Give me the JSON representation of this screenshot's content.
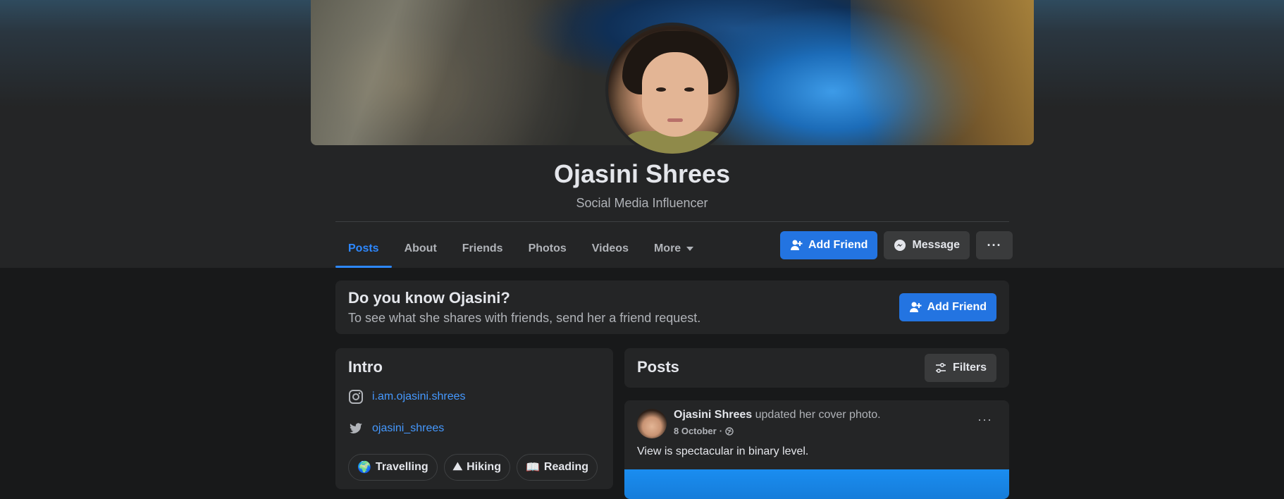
{
  "profile": {
    "name": "Ojasini Shrees",
    "subtitle": "Social Media Influencer"
  },
  "tabs": [
    {
      "label": "Posts",
      "active": true
    },
    {
      "label": "About"
    },
    {
      "label": "Friends"
    },
    {
      "label": "Photos"
    },
    {
      "label": "Videos"
    },
    {
      "label": "More"
    }
  ],
  "actions": {
    "add_friend": "Add Friend",
    "message": "Message",
    "more": "···"
  },
  "know_card": {
    "title": "Do you know Ojasini?",
    "text": "To see what she shares with friends, send her a friend request.",
    "button": "Add Friend"
  },
  "intro": {
    "title": "Intro",
    "links": [
      {
        "icon": "instagram-icon",
        "text": "i.am.ojasini.shrees"
      },
      {
        "icon": "twitter-icon",
        "text": "ojasini_shrees"
      }
    ],
    "hobbies": [
      {
        "emoji": "🌍",
        "label": "Travelling"
      },
      {
        "emoji": "⛰",
        "label": "Hiking"
      },
      {
        "emoji": "📖",
        "label": "Reading"
      }
    ]
  },
  "posts": {
    "title": "Posts",
    "filters": "Filters",
    "items": [
      {
        "author": "Ojasini Shrees",
        "action": "updated her cover photo.",
        "date": "8 October",
        "separator": "·",
        "privacy_icon": "globe-icon",
        "text": "View is spectacular in binary level."
      }
    ]
  },
  "colors": {
    "accent": "#2d88ff",
    "button_blue": "#2374e1",
    "link": "#4599ff",
    "card": "#242526",
    "background": "#18191a"
  }
}
